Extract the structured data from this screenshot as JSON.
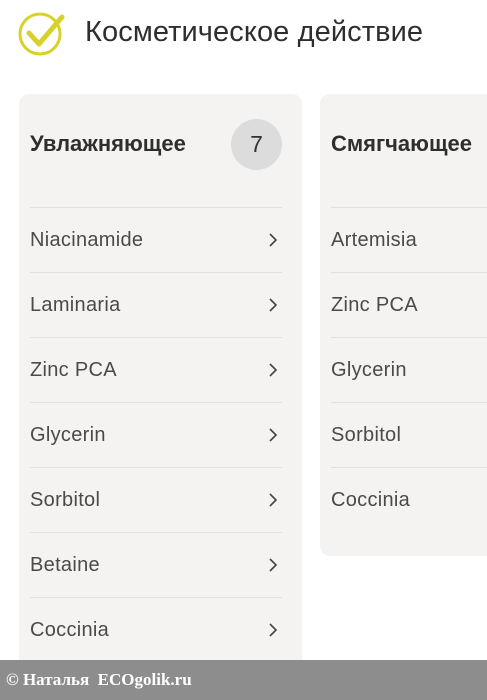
{
  "header": {
    "title": "Косметическое действие",
    "icon": "check-circle-icon",
    "accent_color": "#d7d12a"
  },
  "cards": [
    {
      "title": "Увлажняющее",
      "count": "7",
      "items": [
        "Niacinamide",
        "Laminaria",
        "Zinc PCA",
        "Glycerin",
        "Sorbitol",
        "Betaine",
        "Coccinia"
      ]
    },
    {
      "title": "Смягчающее",
      "items": [
        "Artemisia",
        "Zinc PCA",
        "Glycerin",
        "Sorbitol",
        "Coccinia"
      ]
    }
  ],
  "watermark": {
    "text": "© Наталья  ECOgolik.ru"
  }
}
